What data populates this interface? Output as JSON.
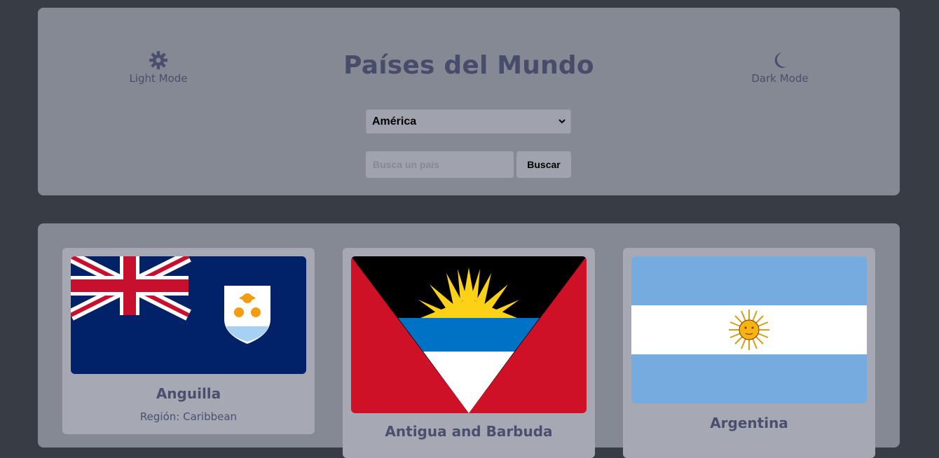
{
  "header": {
    "title": "Países del Mundo",
    "light_mode_label": "Light Mode",
    "dark_mode_label": "Dark Mode",
    "light_icon": "gear-sun-icon",
    "dark_icon": "moon-icon"
  },
  "filters": {
    "region_selected": "América",
    "search_placeholder": "Busca un país",
    "search_button": "Buscar"
  },
  "countries": [
    {
      "name": "Anguilla",
      "region_label": "Región: Caribbean",
      "flag": "anguilla-flag"
    },
    {
      "name": "Antigua and Barbuda",
      "flag": "antigua-barbuda-flag"
    },
    {
      "name": "Argentina",
      "flag": "argentina-flag"
    }
  ],
  "colors": {
    "background": "#383c45",
    "panel": "#858993",
    "card": "#a6a9b3",
    "text_accent": "#474c6b"
  }
}
